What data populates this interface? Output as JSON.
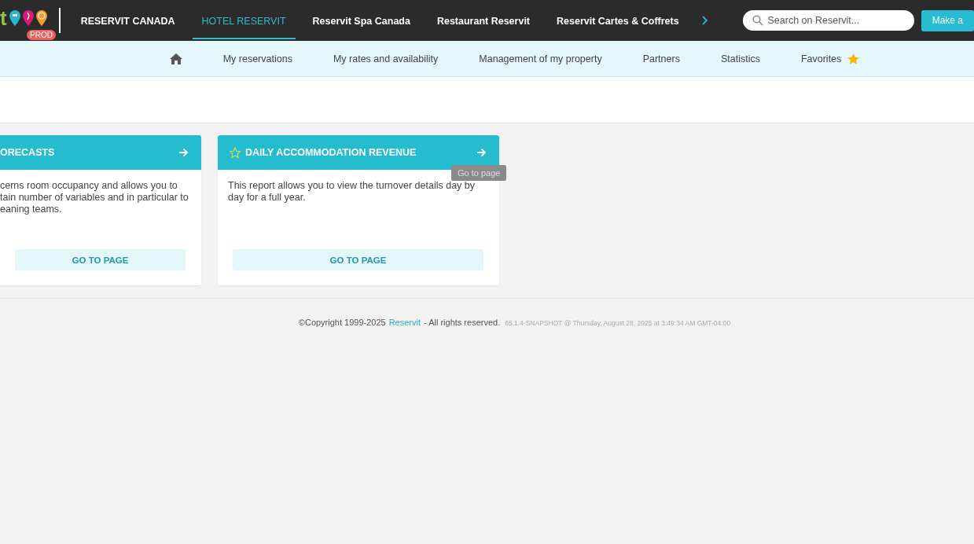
{
  "logo": {
    "letter": "t",
    "badge": "PROD"
  },
  "top_tabs": [
    {
      "label": "RESERVIT CANADA",
      "selected": false
    },
    {
      "label": "HOTEL RESERVIT",
      "selected": true
    },
    {
      "label": "Reservit Spa Canada",
      "selected": false
    },
    {
      "label": "Restaurant Reservit",
      "selected": false
    },
    {
      "label": "Reservit Cartes & Coffrets",
      "selected": false
    }
  ],
  "search": {
    "placeholder": "Search on Reservit..."
  },
  "make_button": "Make a",
  "menu": [
    {
      "kind": "home"
    },
    {
      "kind": "link",
      "label": "My reservations"
    },
    {
      "kind": "link",
      "label": "My rates and availability"
    },
    {
      "kind": "link",
      "label": "Management of my property"
    },
    {
      "kind": "link",
      "label": "Partners"
    },
    {
      "kind": "link",
      "label": "Statistics"
    },
    {
      "kind": "favorites",
      "label": "Favorites"
    }
  ],
  "cards": [
    {
      "title": "ORECASTS",
      "favorite": false,
      "lines": [
        "cerns room occupancy and allows you to",
        "tain number of variables and in particular to",
        "eaning teams."
      ],
      "button": "GO TO PAGE",
      "tooltip": false
    },
    {
      "title": "DAILY ACCOMMODATION REVENUE",
      "favorite": true,
      "lines": [
        "This report allows you to view the turnover details day by",
        "day for a full year."
      ],
      "button": "GO TO PAGE",
      "tooltip": "Go to page"
    }
  ],
  "footer": {
    "copyright": "©Copyright 1999-2025",
    "link": "Reservit",
    "rights": "- All rights reserved.",
    "version": "65.1.4-SNAPSHOT @ Thursday, August 28, 2025 at 3:49:34 AM GMT-04:00"
  }
}
